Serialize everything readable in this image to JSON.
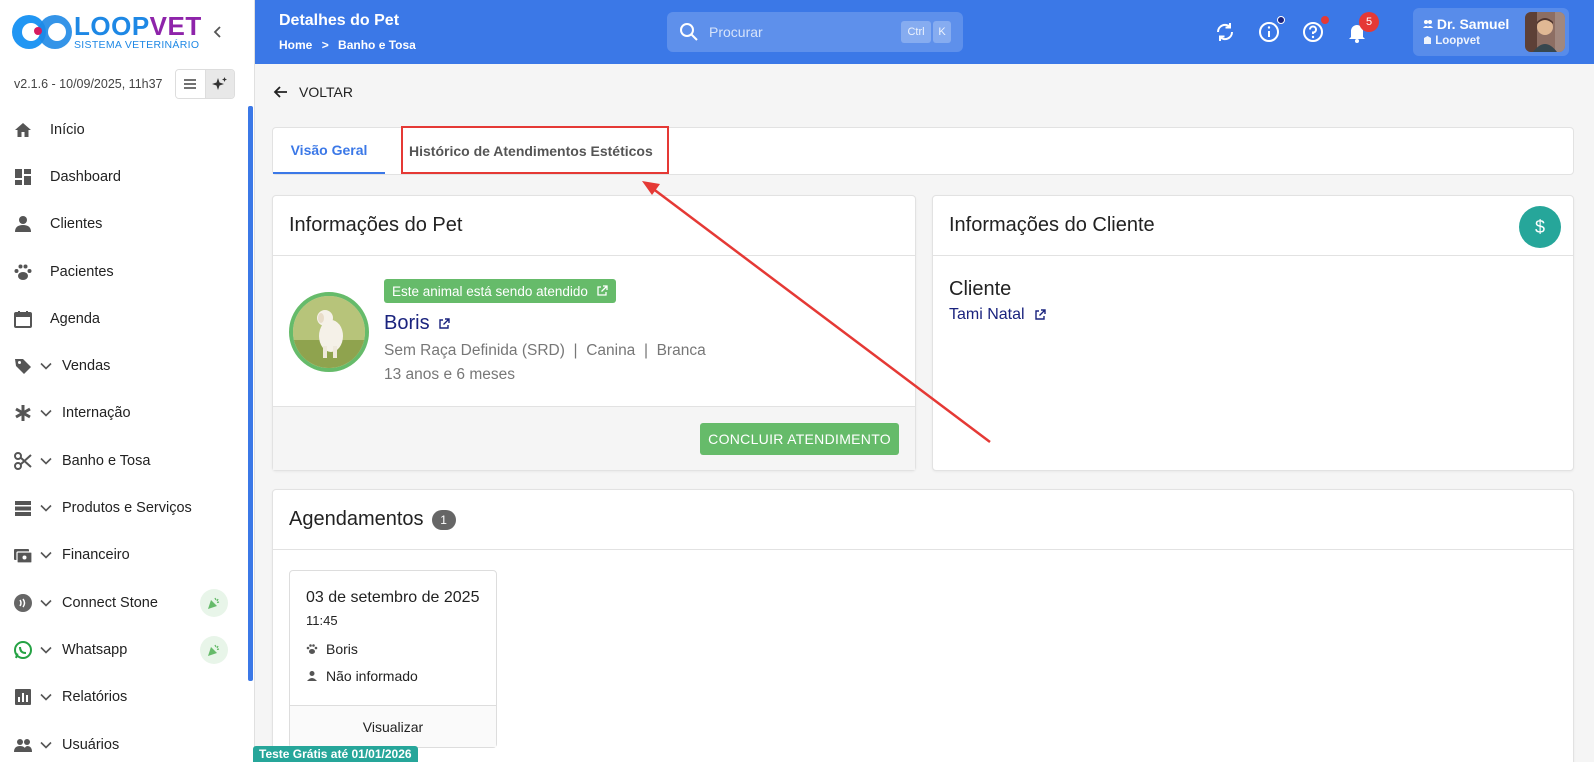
{
  "sidebar": {
    "logo_brand_1": "LOOP",
    "logo_brand_2": "VET",
    "logo_sub": "SISTEMA VETERINÁRIO",
    "version": "v2.1.6 - 10/09/2025, 11h37",
    "items": [
      {
        "label": "Início",
        "icon": "home-icon",
        "chevron": false
      },
      {
        "label": "Dashboard",
        "icon": "dashboard-icon",
        "chevron": false
      },
      {
        "label": "Clientes",
        "icon": "person-icon",
        "chevron": false
      },
      {
        "label": "Pacientes",
        "icon": "paw-icon",
        "chevron": false
      },
      {
        "label": "Agenda",
        "icon": "calendar-icon",
        "chevron": false
      },
      {
        "label": "Vendas",
        "icon": "tag-icon",
        "chevron": true
      },
      {
        "label": "Internação",
        "icon": "asterisk-icon",
        "chevron": true
      },
      {
        "label": "Banho e Tosa",
        "icon": "scissors-icon",
        "chevron": true
      },
      {
        "label": "Produtos e Serviços",
        "icon": "list-icon",
        "chevron": true
      },
      {
        "label": "Financeiro",
        "icon": "cash-icon",
        "chevron": true
      },
      {
        "label": "Connect Stone",
        "icon": "nfc-icon",
        "chevron": true,
        "promo": true
      },
      {
        "label": "Whatsapp",
        "icon": "whatsapp-icon",
        "chevron": true,
        "promo": true
      },
      {
        "label": "Relatórios",
        "icon": "chart-icon",
        "chevron": true
      },
      {
        "label": "Usuários",
        "icon": "users-icon",
        "chevron": true
      }
    ]
  },
  "header": {
    "title": "Detalhes do Pet",
    "breadcrumb": [
      "Home",
      ">",
      "Banho e Tosa"
    ],
    "search_placeholder": "Procurar",
    "kbd_1": "Ctrl",
    "kbd_2": "K",
    "notifications_count": "5",
    "user_name": "Dr. Samuel",
    "user_org": "Loopvet"
  },
  "main": {
    "back_label": "VOLTAR",
    "tabs": [
      {
        "label": "Visão Geral",
        "active": true
      },
      {
        "label": "Histórico de Atendimentos Estéticos",
        "active": false
      }
    ],
    "pet": {
      "card_title": "Informações do Pet",
      "status_chip": "Este animal está sendo atendido",
      "name": "Boris",
      "breed": "Sem Raça Definida (SRD)",
      "species": "Canina",
      "color": "Branca",
      "sep": "|",
      "age": "13 anos e 6 meses",
      "finish_button": "CONCLUIR ATENDIMENTO"
    },
    "client": {
      "card_title": "Informações do Cliente",
      "label": "Cliente",
      "name": "Tami Natal",
      "money_symbol": "$"
    },
    "schedule": {
      "title": "Agendamentos",
      "count": "1",
      "appointments": [
        {
          "date": "03 de setembro de 2025",
          "time": "11:45",
          "pet": "Boris",
          "vet": "Não informado",
          "action": "Visualizar"
        }
      ]
    },
    "trial_banner": "Teste Grátis até 01/01/2026"
  },
  "colors": {
    "primary": "#3b78e7",
    "success": "#66bb6a",
    "teal": "#26a69a",
    "annotation_red": "#e53935"
  }
}
